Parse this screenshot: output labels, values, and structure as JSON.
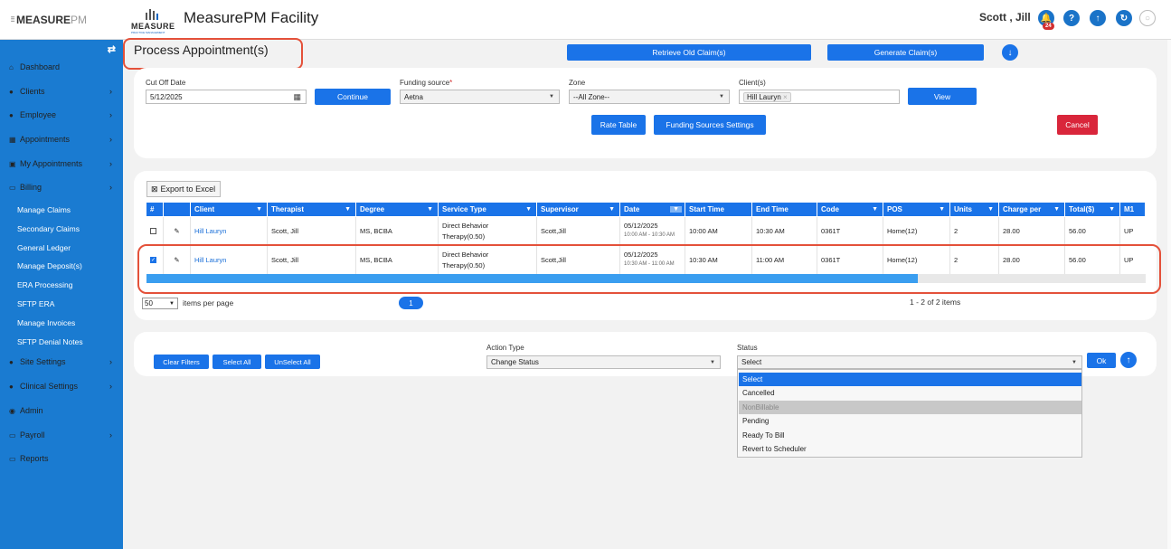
{
  "header": {
    "side_logo_main": "MEASURE",
    "side_logo_pm": "PM",
    "logo_word": "MEASURE",
    "logo_tag": "PRACTICE MANAGEMENT",
    "app_title": "MeasurePM Facility",
    "user_name": "Scott , Jill",
    "notification_count": "24",
    "icons": [
      "bell-icon",
      "help-icon",
      "upload-icon",
      "refresh-icon",
      "user-avatar-icon"
    ]
  },
  "sidebar": {
    "toggle": "⇄",
    "items": [
      {
        "label": "Dashboard",
        "icon": "⌂",
        "chev": ""
      },
      {
        "label": "Clients",
        "icon": "●",
        "chev": "›"
      },
      {
        "label": "Employee",
        "icon": "●",
        "chev": "›"
      },
      {
        "label": "Appointments",
        "icon": "▦",
        "chev": "›"
      },
      {
        "label": "My Appointments",
        "icon": "▣",
        "chev": "›"
      },
      {
        "label": "Billing",
        "icon": "▭",
        "chev": "›"
      },
      {
        "label": "Manage Claims"
      },
      {
        "label": "Secondary Claims"
      },
      {
        "label": "General Ledger"
      },
      {
        "label": "Manage Deposit(s)"
      },
      {
        "label": "ERA Processing"
      },
      {
        "label": "SFTP ERA"
      },
      {
        "label": "Manage Invoices"
      },
      {
        "label": "SFTP Denial Notes"
      },
      {
        "label": "Site Settings",
        "icon": "●",
        "chev": "›"
      },
      {
        "label": "Clinical Settings",
        "icon": "●",
        "chev": "›"
      },
      {
        "label": "Admin",
        "icon": "◉",
        "chev": ""
      },
      {
        "label": "Payroll",
        "icon": "▭",
        "chev": "›"
      },
      {
        "label": "Reports",
        "icon": "▭",
        "chev": ""
      }
    ]
  },
  "page": {
    "title": "Process Appointment(s)",
    "retrieve_btn": "Retrieve Old Claim(s)",
    "generate_btn": "Generate Claim(s)",
    "down_icon": "↓"
  },
  "filters": {
    "cutoff_label": "Cut Off Date",
    "cutoff_value": "5/12/2025",
    "continue_btn": "Continue",
    "funding_label": "Funding source",
    "funding_required": "*",
    "funding_value": "Aetna",
    "zone_label": "Zone",
    "zone_value": "--All Zone--",
    "client_label": "Client(s)",
    "client_chip": "Hill Lauryn",
    "view_btn": "View",
    "rate_table_btn": "Rate Table",
    "funding_settings_btn": "Funding Sources Settings",
    "cancel_btn": "Cancel"
  },
  "table": {
    "export_label": "Export to Excel",
    "columns": [
      "#",
      "",
      "Client",
      "Therapist",
      "Degree",
      "Service Type",
      "Supervisor",
      "Date",
      "Start Time",
      "End Time",
      "Code",
      "POS",
      "Units",
      "Charge per",
      "Total($)",
      "M1"
    ],
    "rows": [
      {
        "checked": "",
        "client": "Hill Lauryn",
        "therapist": "Scott, Jill",
        "degree": "MS, BCBA",
        "service1": "Direct Behavior",
        "service2": "Therapy(0.50)",
        "supervisor": "Scott,Jill",
        "date": "05/12/2025",
        "date_range": "10:00 AM - 10:30 AM",
        "start": "10:00 AM",
        "end": "10:30 AM",
        "code": "0361T",
        "pos": "Home(12)",
        "units": "2",
        "charge": "28.00",
        "total": "56.00",
        "m1": "UP"
      },
      {
        "checked": "✓",
        "client": "Hill Lauryn",
        "therapist": "Scott, Jill",
        "degree": "MS, BCBA",
        "service1": "Direct Behavior",
        "service2": "Therapy(0.50)",
        "supervisor": "Scott,Jill",
        "date": "05/12/2025",
        "date_range": "10:30 AM - 11:00 AM",
        "start": "10:30 AM",
        "end": "11:00 AM",
        "code": "0361T",
        "pos": "Home(12)",
        "units": "2",
        "charge": "28.00",
        "total": "56.00",
        "m1": "UP"
      }
    ]
  },
  "pager": {
    "page_size": "50",
    "items_per_page": "items per page",
    "current_page": "1",
    "summary": "1 - 2 of 2 items"
  },
  "actions": {
    "clear_filters": "Clear Filters",
    "select_all": "Select All",
    "unselect_all": "UnSelect All",
    "action_type_label": "Action Type",
    "action_type_value": "Change Status",
    "status_label": "Status",
    "status_value": "Select",
    "ok_btn": "Ok",
    "up_icon": "↑",
    "status_options": [
      "Select",
      "Cancelled",
      "NonBillable",
      "Pending",
      "Ready To Bill",
      "Revert to Scheduler"
    ]
  }
}
